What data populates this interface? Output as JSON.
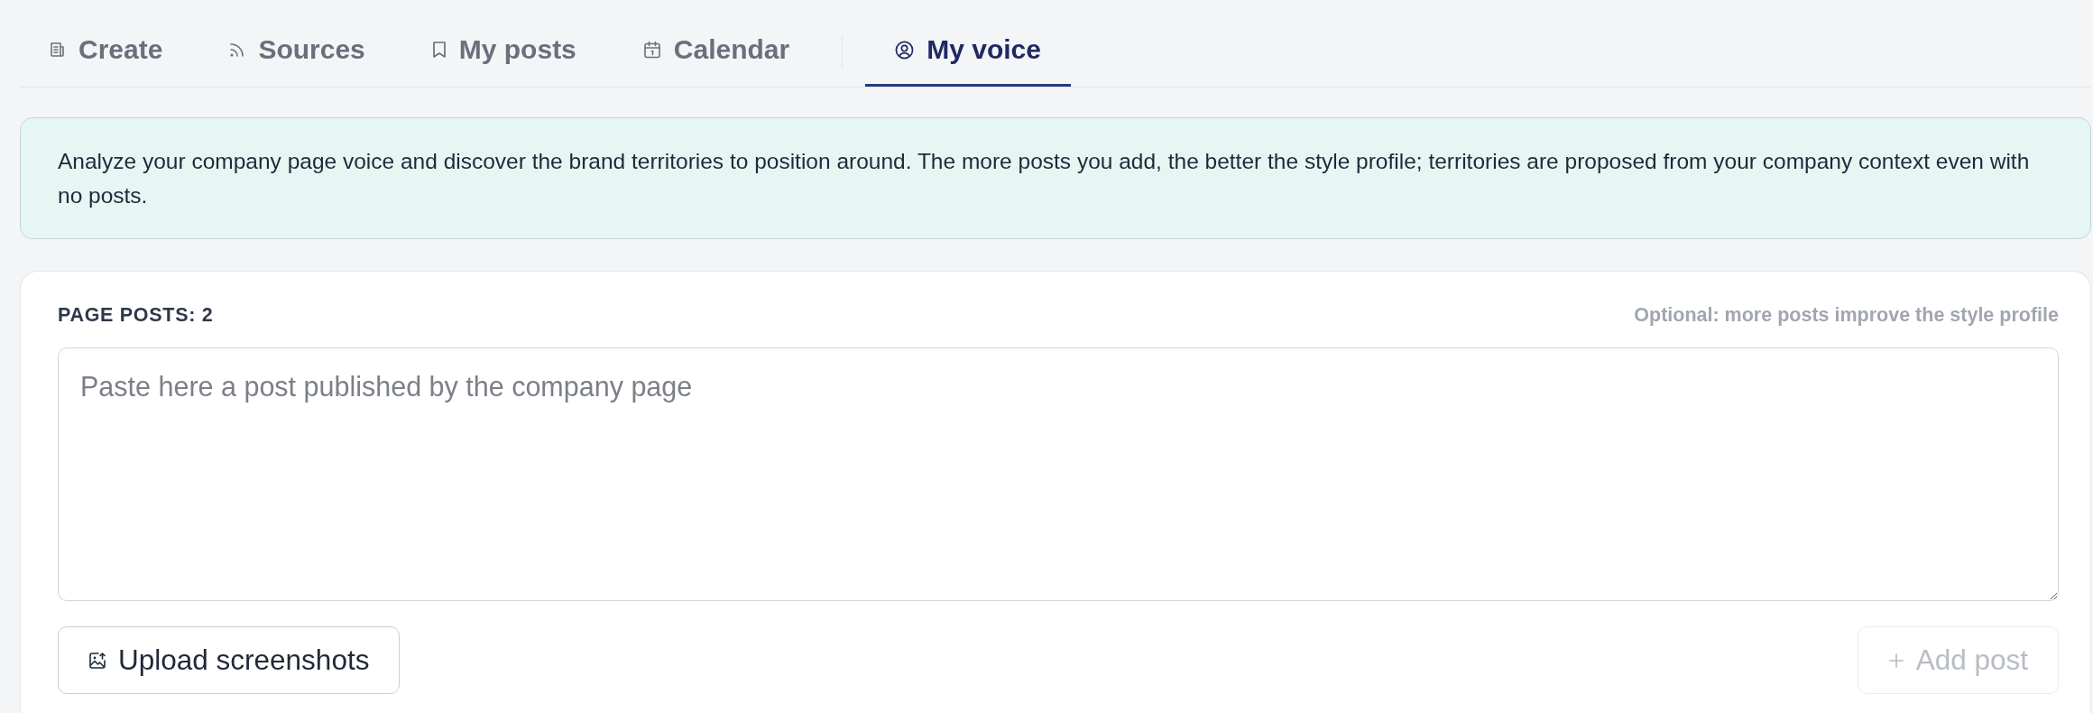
{
  "tab_groups": [
    {
      "tabs": [
        {
          "label": "Create",
          "selected": false
        },
        {
          "label": "Sources",
          "selected": false
        },
        {
          "label": "My posts",
          "selected": false
        },
        {
          "label": "Calendar",
          "selected": false
        }
      ]
    },
    {
      "tabs": [
        {
          "label": "My voice",
          "selected": true
        }
      ]
    }
  ],
  "info_banner": {
    "text": "Analyze your company page voice and discover the brand territories to position around. The more posts you add, the better the style profile; territories are proposed from your company context even with no posts."
  },
  "posts_card": {
    "title": "PAGE POSTS: 2",
    "hint": "Optional: more posts improve the style profile",
    "post_field": {
      "placeholder": "Paste here a post published by the company page"
    },
    "buttons": [
      {
        "kind": "upload",
        "label": "Upload screenshots",
        "disabled": false
      },
      {
        "kind": "add",
        "label": "Add post",
        "disabled": true
      }
    ]
  }
}
